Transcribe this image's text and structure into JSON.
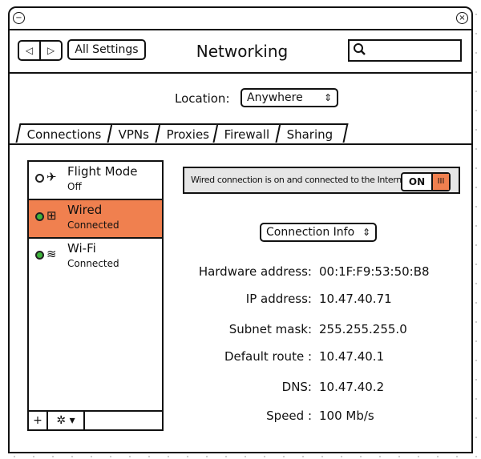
{
  "window": {
    "title": "Networking",
    "minimize_icon": "−",
    "close_icon": "×"
  },
  "toolbar": {
    "back_label": "◁",
    "forward_label": "▷",
    "all_settings_label": "All Settings",
    "search_placeholder": ""
  },
  "location": {
    "label": "Location:",
    "value": "Anywhere"
  },
  "tabs": [
    {
      "label": "Connections",
      "active": true
    },
    {
      "label": "VPNs"
    },
    {
      "label": "Proxies"
    },
    {
      "label": "Firewall"
    },
    {
      "label": "Sharing"
    }
  ],
  "connections": [
    {
      "name": "Flight Mode",
      "status": "Off",
      "icon": "✈",
      "status_dot": "off",
      "selected": false
    },
    {
      "name": "Wired",
      "status": "Connected",
      "icon": "⊞",
      "status_dot": "green",
      "selected": true
    },
    {
      "name": "Wi-Fi",
      "status": "Connected",
      "icon": "≋",
      "status_dot": "green",
      "selected": false
    }
  ],
  "list_footer": {
    "add_label": "+",
    "gear_label": "✲ ▾"
  },
  "banner": {
    "message": "Wired connection is on and connected to the Internet.",
    "toggle_label": "ON",
    "toggle_grip": "III"
  },
  "info_select": {
    "value": "Connection Info"
  },
  "info": [
    {
      "label": "Hardware address:",
      "value": "00:1F:F9:53:50:B8"
    },
    {
      "label": "IP address:",
      "value": "10.47.40.71"
    },
    {
      "label": "Subnet mask:",
      "value": "255.255.255.0"
    },
    {
      "label": "Default route :",
      "value": "10.47.40.1"
    },
    {
      "label": "DNS:",
      "value": "10.47.40.2"
    },
    {
      "label": "Speed :",
      "value": "100 Mb/s"
    }
  ],
  "colors": {
    "accent": "#f0804f",
    "status_green": "#3eb43c",
    "banner_bg": "#e6e6e6"
  }
}
